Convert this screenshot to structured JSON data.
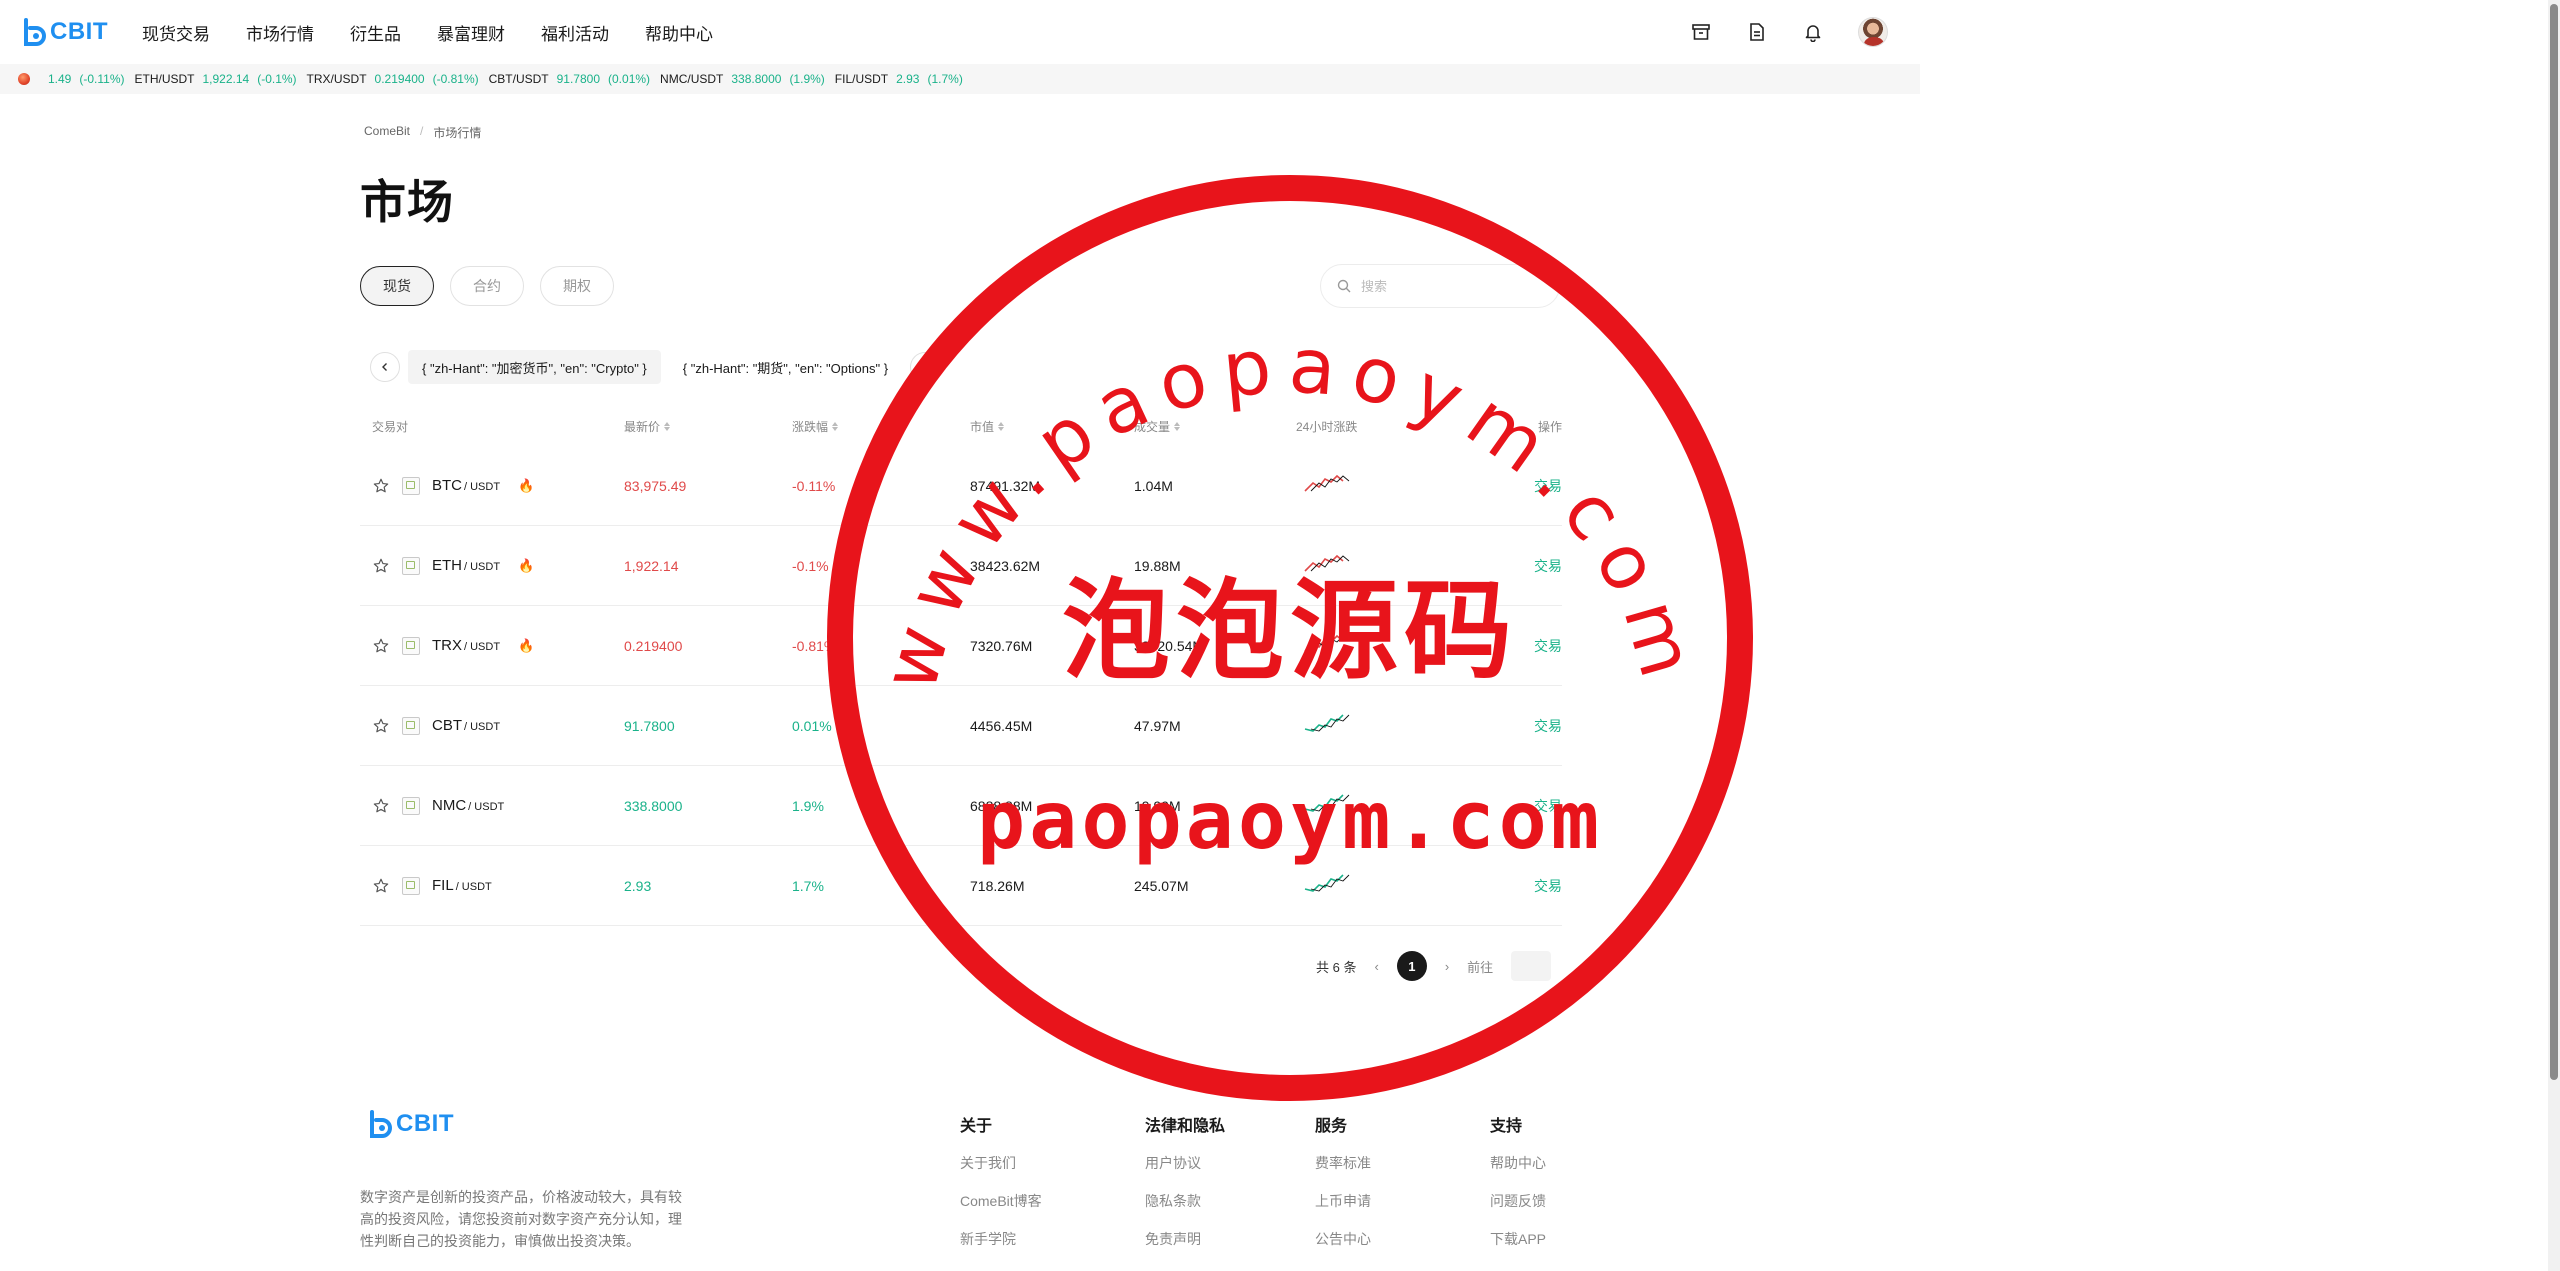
{
  "brand": {
    "name": "CBIT",
    "color": "#1f8ff0"
  },
  "nav": {
    "items": [
      {
        "label": "现货交易",
        "name": "nav-spot"
      },
      {
        "label": "市场行情",
        "name": "nav-market"
      },
      {
        "label": "衍生品",
        "name": "nav-derivatives"
      },
      {
        "label": "暴富理财",
        "name": "nav-finance"
      },
      {
        "label": "福利活动",
        "name": "nav-activities"
      },
      {
        "label": "帮助中心",
        "name": "nav-help"
      }
    ],
    "icons": [
      "archive-icon",
      "document-icon",
      "bell-icon"
    ]
  },
  "ticker": [
    {
      "sym": "",
      "price": "1.49",
      "change": "(-0.11%)"
    },
    {
      "sym": "ETH/USDT",
      "price": "1,922.14",
      "change": "(-0.1%)"
    },
    {
      "sym": "TRX/USDT",
      "price": "0.219400",
      "change": "(-0.81%)"
    },
    {
      "sym": "CBT/USDT",
      "price": "91.7800",
      "change": "(0.01%)"
    },
    {
      "sym": "NMC/USDT",
      "price": "338.8000",
      "change": "(1.9%)"
    },
    {
      "sym": "FIL/USDT",
      "price": "2.93",
      "change": "(1.7%)"
    }
  ],
  "breadcrumb": {
    "home": "ComeBit",
    "sep": "/",
    "current": "市场行情"
  },
  "page_title": "市场",
  "segments": [
    {
      "label": "现货",
      "active": true
    },
    {
      "label": "合约",
      "active": false
    },
    {
      "label": "期权",
      "active": false
    }
  ],
  "search": {
    "placeholder": "搜索"
  },
  "categories": [
    "{ \"zh-Hant\": \"加密货币\", \"en\": \"Crypto\" }",
    "{ \"zh-Hant\": \"期货\", \"en\": \"Options\" }"
  ],
  "table": {
    "headers": {
      "pair": "交易对",
      "price": "最新价",
      "change": "涨跌幅",
      "cap": "市值",
      "volume": "成交量",
      "trend": "24小时涨跌",
      "action": "操作"
    },
    "rows": [
      {
        "sym": "BTC",
        "quote": "/ USDT",
        "hot": true,
        "price": "83,975.49",
        "change": "-0.11%",
        "cap": "87491.32M",
        "volume": "1.04M",
        "trend": "down",
        "action": "交易"
      },
      {
        "sym": "ETH",
        "quote": "/ USDT",
        "hot": true,
        "price": "1,922.14",
        "change": "-0.1%",
        "cap": "38423.62M",
        "volume": "19.88M",
        "trend": "down",
        "action": "交易"
      },
      {
        "sym": "TRX",
        "quote": "/ USDT",
        "hot": true,
        "price": "0.219400",
        "change": "-0.81%",
        "cap": "7320.76M",
        "volume": "33020.54M",
        "trend": "down",
        "action": "交易"
      },
      {
        "sym": "CBT",
        "quote": "/ USDT",
        "hot": false,
        "price": "91.7800",
        "change": "0.01%",
        "cap": "4456.45M",
        "volume": "47.97M",
        "trend": "up",
        "action": "交易"
      },
      {
        "sym": "NMC",
        "quote": "/ USDT",
        "hot": false,
        "price": "338.8000",
        "change": "1.9%",
        "cap": "6888.88M",
        "volume": "19.99M",
        "trend": "up",
        "action": "交易"
      },
      {
        "sym": "FIL",
        "quote": "/ USDT",
        "hot": false,
        "price": "2.93",
        "change": "1.7%",
        "cap": "718.26M",
        "volume": "245.07M",
        "trend": "up",
        "action": "交易"
      }
    ]
  },
  "pager": {
    "total": "共 6 条",
    "current": "1",
    "goto": "前往"
  },
  "footer": {
    "desc": "数字资产是创新的投资产品，价格波动较大，具有较高的投资风险，请您投资前对数字资产充分认知，理性判断自己的投资能力，审慎做出投资决策。",
    "columns": [
      {
        "title": "关于",
        "links": [
          "关于我们",
          "ComeBit博客",
          "新手学院"
        ]
      },
      {
        "title": "法律和隐私",
        "links": [
          "用户协议",
          "隐私条款",
          "免责声明"
        ]
      },
      {
        "title": "服务",
        "links": [
          "费率标准",
          "上币申请",
          "公告中心"
        ]
      },
      {
        "title": "支持",
        "links": [
          "帮助中心",
          "问题反馈",
          "下载APP"
        ]
      }
    ]
  },
  "watermark": {
    "url_arc": "www.paopaoym.com",
    "cn": "泡泡源码",
    "url": "paopaoym.com",
    "color": "#e8141b"
  },
  "colors": {
    "up": "#1ab28a",
    "down": "#e04a4a",
    "accent": "#1f8ff0"
  }
}
